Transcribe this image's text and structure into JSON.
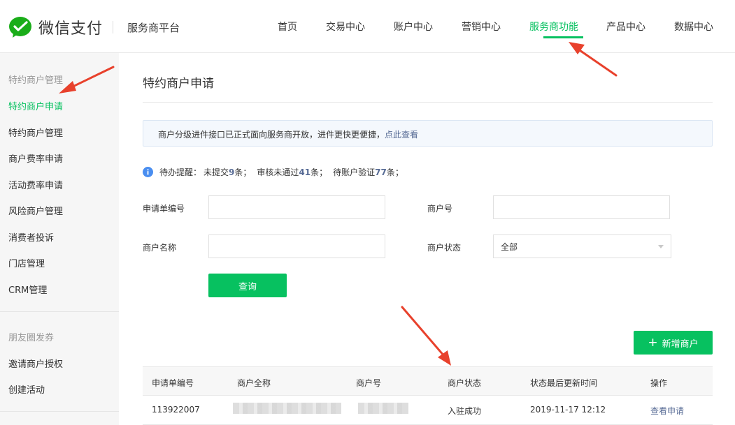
{
  "header": {
    "brand": "微信支付",
    "platform": "服务商平台",
    "nav": [
      "首页",
      "交易中心",
      "账户中心",
      "营销中心",
      "服务商功能",
      "产品中心",
      "数据中心"
    ],
    "active_nav": "服务商功能"
  },
  "sidebar": {
    "groups": [
      {
        "title": "特约商户管理",
        "items": [
          "特约商户申请",
          "特约商户管理",
          "商户费率申请",
          "活动费率申请",
          "风险商户管理",
          "消费者投诉",
          "门店管理",
          "CRM管理"
        ]
      },
      {
        "title": "朋友圈发券",
        "items": [
          "邀请商户授权",
          "创建活动"
        ]
      }
    ],
    "active_item": "特约商户申请"
  },
  "main": {
    "title": "特约商户申请",
    "notice": {
      "text": "商户分级进件接口已正式面向服务商开放，进件更快更便捷，",
      "link": "点此查看"
    },
    "todo": {
      "prefix": "待办提醒：",
      "unsubmitted_label": "未提交",
      "unsubmitted_count": "9",
      "unsubmitted_unit": "条；",
      "rejected_label": "审核未通过",
      "rejected_count": "41",
      "rejected_unit": "条；",
      "verify_label": "待账户验证",
      "verify_count": "77",
      "verify_unit": "条；"
    },
    "form": {
      "application_no_label": "申请单编号",
      "application_no_value": "",
      "merchant_id_label": "商户号",
      "merchant_id_value": "",
      "merchant_name_label": "商户名称",
      "merchant_name_value": "",
      "merchant_status_label": "商户状态",
      "merchant_status_value": "全部",
      "query_button": "查询"
    },
    "add_button": "新增商户",
    "table": {
      "columns": [
        "申请单编号",
        "商户全称",
        "商户号",
        "商户状态",
        "状态最后更新时间",
        "操作"
      ],
      "rows": [
        {
          "application_no": "113922007",
          "merchant_name": "",
          "merchant_id": "",
          "status": "入驻成功",
          "updated_at": "2019-11-17 12:12",
          "action": "查看申请"
        }
      ]
    }
  },
  "colors": {
    "accent": "#07c160",
    "link": "#576b95",
    "annotation": "#e8412c"
  },
  "icons": [
    "wechat-pay-logo-icon",
    "info-icon",
    "plus-icon",
    "chevron-down-icon"
  ]
}
